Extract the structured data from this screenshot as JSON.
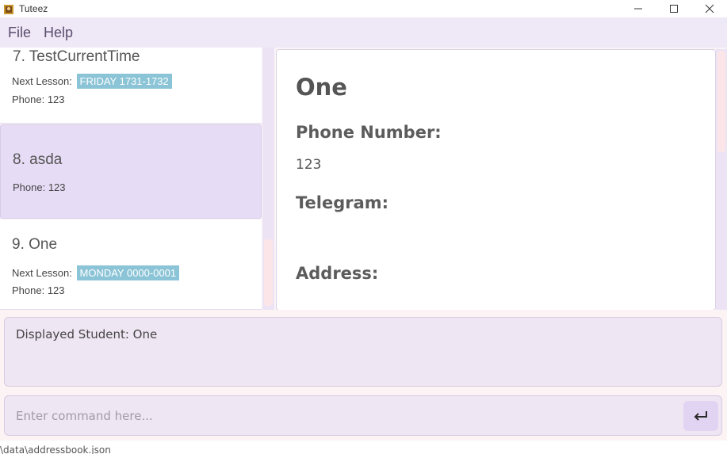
{
  "window": {
    "title": "Tuteez",
    "controls": [
      "minimize-icon",
      "maximize-icon",
      "close-icon"
    ]
  },
  "menu": {
    "items": [
      {
        "label": "File"
      },
      {
        "label": "Help"
      }
    ]
  },
  "student_list": {
    "cards": [
      {
        "index_name": "7. TestCurrentTime",
        "next_lesson_label": "Next Lesson:",
        "next_lesson": "FRIDAY 1731-1732",
        "phone_label": "Phone:",
        "phone": "123"
      },
      {
        "index_name": "8. asda",
        "phone_label": "Phone:",
        "phone": "123",
        "selected": true
      },
      {
        "index_name": "9. One",
        "next_lesson_label": "Next Lesson:",
        "next_lesson": "MONDAY 0000-0001",
        "phone_label": "Phone:",
        "phone": "123"
      }
    ]
  },
  "detail": {
    "name": "One",
    "phone_label": "Phone Number:",
    "phone": "123",
    "telegram_label": "Telegram:",
    "telegram": "",
    "address_label": "Address:"
  },
  "result": {
    "text": "Displayed Student: One"
  },
  "command": {
    "placeholder": "Enter command here...",
    "value": "",
    "enter_icon": "enter-return-icon"
  },
  "status": {
    "path": "\\data\\addressbook.json"
  },
  "colors": {
    "menubar_bg": "#efe8f6",
    "selected_card": "#e6dcf5",
    "lesson_tag": "#8bc4d6",
    "panel_bg": "#faf3f6",
    "scroll_thumb": "#fbe5e8"
  }
}
